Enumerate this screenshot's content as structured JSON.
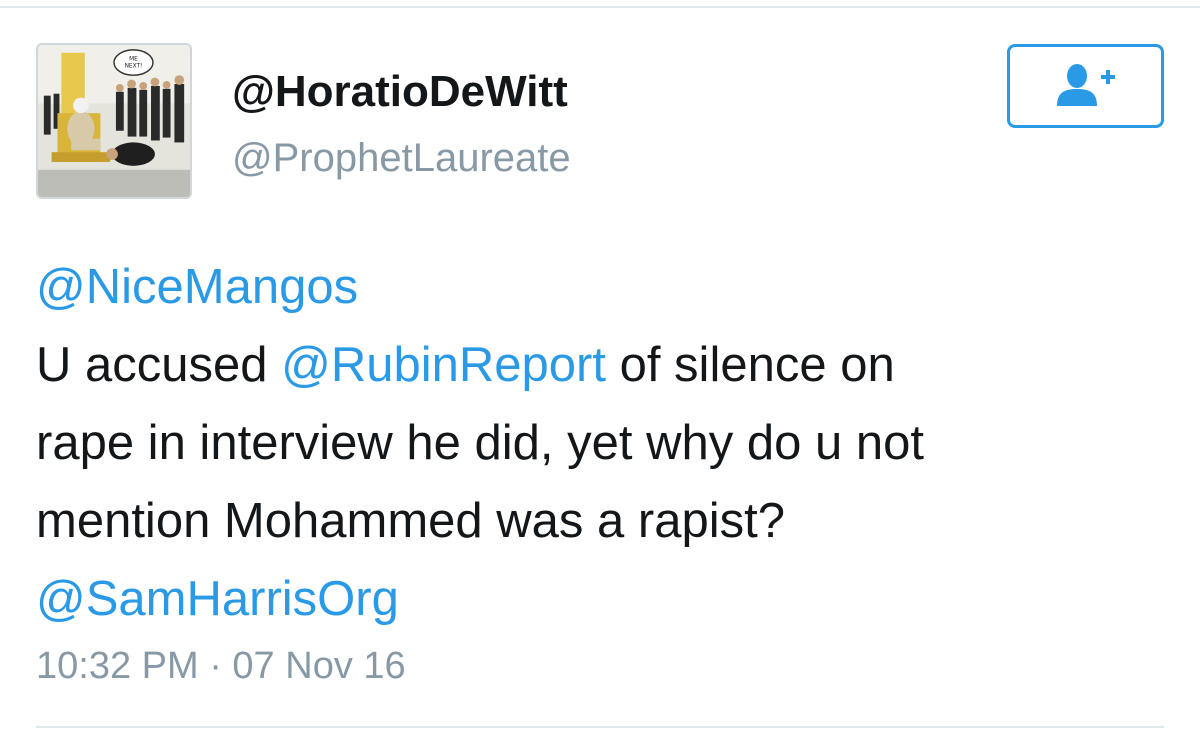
{
  "author": {
    "display_name": "@HoratioDeWitt",
    "handle": "@ProphetLaureate",
    "avatar_icon": "cartoon-avatar",
    "avatar_caption": "ME NEXT!"
  },
  "follow_button": {
    "icon": "add-user-icon",
    "color": "#2b9ae6"
  },
  "tweet": {
    "reply_to": "@NiceMangos",
    "line2_pre": "U accused ",
    "mention_2": "@RubinReport",
    "line2_post": " of silence on",
    "line3": "rape in interview he did, yet why do u not",
    "line4": "mention Mohammed was a rapist?",
    "mention_3": "@SamHarrisOrg",
    "timestamp": "10:32 PM · 07 Nov 16"
  },
  "colors": {
    "link": "#2b9ae6",
    "text": "#14171a",
    "muted": "#8899a6",
    "divider": "#e1e8ed"
  }
}
